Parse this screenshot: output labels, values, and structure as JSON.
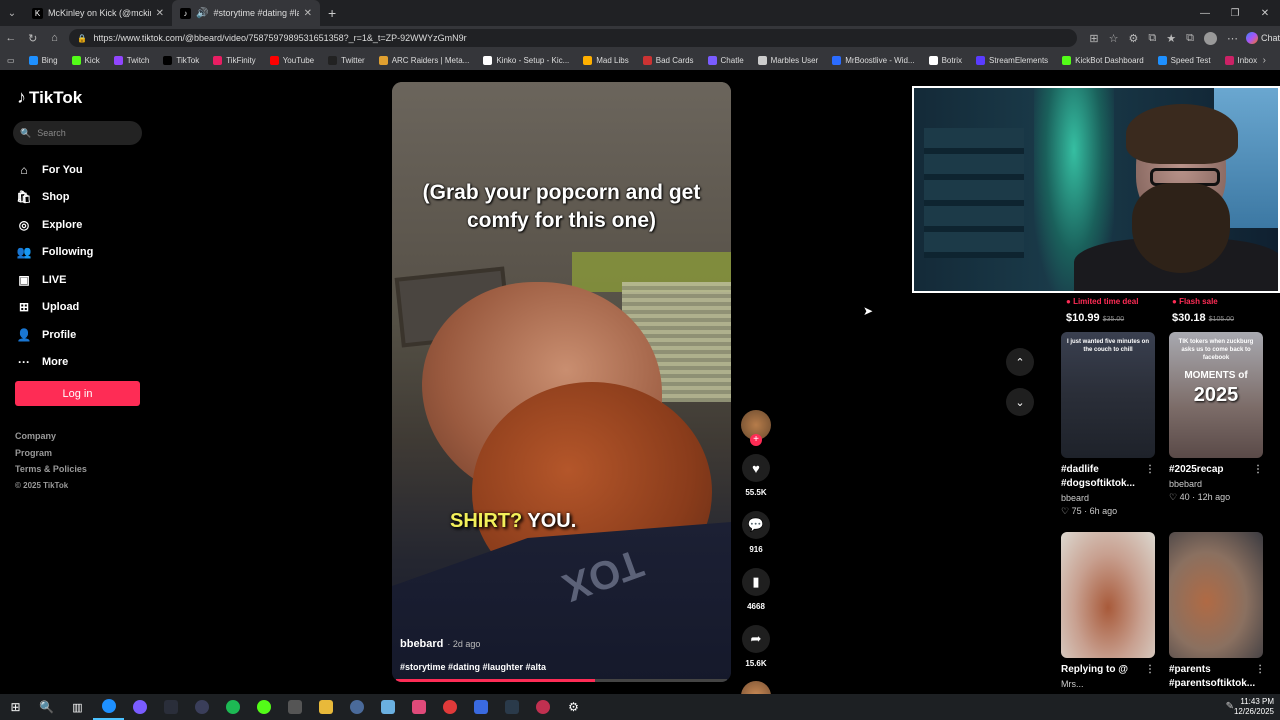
{
  "browser": {
    "tabs": [
      {
        "title": "McKinley on Kick (@mckinley.tv) |",
        "fav": "K"
      },
      {
        "title": "#storytime #dating #laughter",
        "fav": "♪"
      }
    ],
    "url": "https://www.tiktok.com/@bbeard/video/7587597989531651358?_r=1&_t=ZP-92WWYzGmN9r",
    "chat_label": "Chat",
    "bookmarks": [
      {
        "label": "Bing",
        "color": "#1e90ff"
      },
      {
        "label": "Kick",
        "color": "#53fc18"
      },
      {
        "label": "Twitch",
        "color": "#9146ff"
      },
      {
        "label": "TikTok",
        "color": "#000000"
      },
      {
        "label": "TikFinity",
        "color": "#e91e63"
      },
      {
        "label": "YouTube",
        "color": "#ff0000"
      },
      {
        "label": "Twitter",
        "color": "#222222"
      },
      {
        "label": "ARC Raiders | Meta...",
        "color": "#e0a030"
      },
      {
        "label": "Kinko - Setup - Kic...",
        "color": "#ffffff"
      },
      {
        "label": "Mad Libs",
        "color": "#ffb000"
      },
      {
        "label": "Bad Cards",
        "color": "#cc3333"
      },
      {
        "label": "Chatle",
        "color": "#7a5cff"
      },
      {
        "label": "Marbles User",
        "color": "#cccccc"
      },
      {
        "label": "MrBoostlive - Wid...",
        "color": "#2b6cff"
      },
      {
        "label": "Botrix",
        "color": "#ffffff"
      },
      {
        "label": "StreamElements",
        "color": "#5a3cff"
      },
      {
        "label": "KickBot Dashboard",
        "color": "#53fc18"
      },
      {
        "label": "Speed Test",
        "color": "#1e90ff"
      },
      {
        "label": "Inbox",
        "color": "#cc2266"
      }
    ]
  },
  "sidebar": {
    "logo": "TikTok",
    "search_placeholder": "Search",
    "items": [
      {
        "label": "For You",
        "icon": "⌂"
      },
      {
        "label": "Shop",
        "icon": "🛍"
      },
      {
        "label": "Explore",
        "icon": "◎"
      },
      {
        "label": "Following",
        "icon": "👥"
      },
      {
        "label": "LIVE",
        "icon": "▣"
      },
      {
        "label": "Upload",
        "icon": "⊞"
      },
      {
        "label": "Profile",
        "icon": "👤"
      },
      {
        "label": "More",
        "icon": "···"
      }
    ],
    "login_label": "Log in",
    "footer": [
      "Company",
      "Program",
      "Terms & Policies"
    ],
    "copyright": "© 2025 TikTok"
  },
  "video": {
    "caption_top": "(Grab your popcorn and get comfy for this one)",
    "caption_bottom_highlight": "SHIRT?",
    "caption_bottom_rest": " YOU.",
    "shirt_text": "TOX",
    "author": "bbebard",
    "age": "· 2d ago",
    "tags": "#storytime #dating #laughter #alta",
    "progress_percent": 60,
    "actions": {
      "likes": "55.5K",
      "comments": "916",
      "saves": "4668",
      "shares": "15.6K"
    }
  },
  "recs": {
    "deals": [
      {
        "label": "Limited time deal",
        "price": "$10.99",
        "old": "$35.00"
      },
      {
        "label": "Flash sale",
        "price": "$30.18",
        "old": "$105.00"
      }
    ],
    "cards": [
      {
        "overlay": "I just wanted five minutes on the couch to chill",
        "big": "",
        "desc": "#dadlife #dogsoftiktok...",
        "author": "bbeard",
        "likes": "75",
        "ago": "6h ago"
      },
      {
        "overlay": "TIK tokers when zuckburg asks us to come back to facebook",
        "big": "2025",
        "desc": "#2025recap",
        "author": "bbebard",
        "likes": "40",
        "ago": "12h ago"
      },
      {
        "overlay": "",
        "big": "",
        "desc": "Replying to @",
        "author": "Mrs...",
        "likes": "",
        "ago": ""
      },
      {
        "overlay": "",
        "big": "",
        "desc": "#parents #parentsoftiktok...",
        "author": "",
        "likes": "",
        "ago": ""
      }
    ],
    "moments_text": "MOMENTS of"
  },
  "taskbar": {
    "time": "11:43 PM",
    "date": "12/26/2025"
  }
}
